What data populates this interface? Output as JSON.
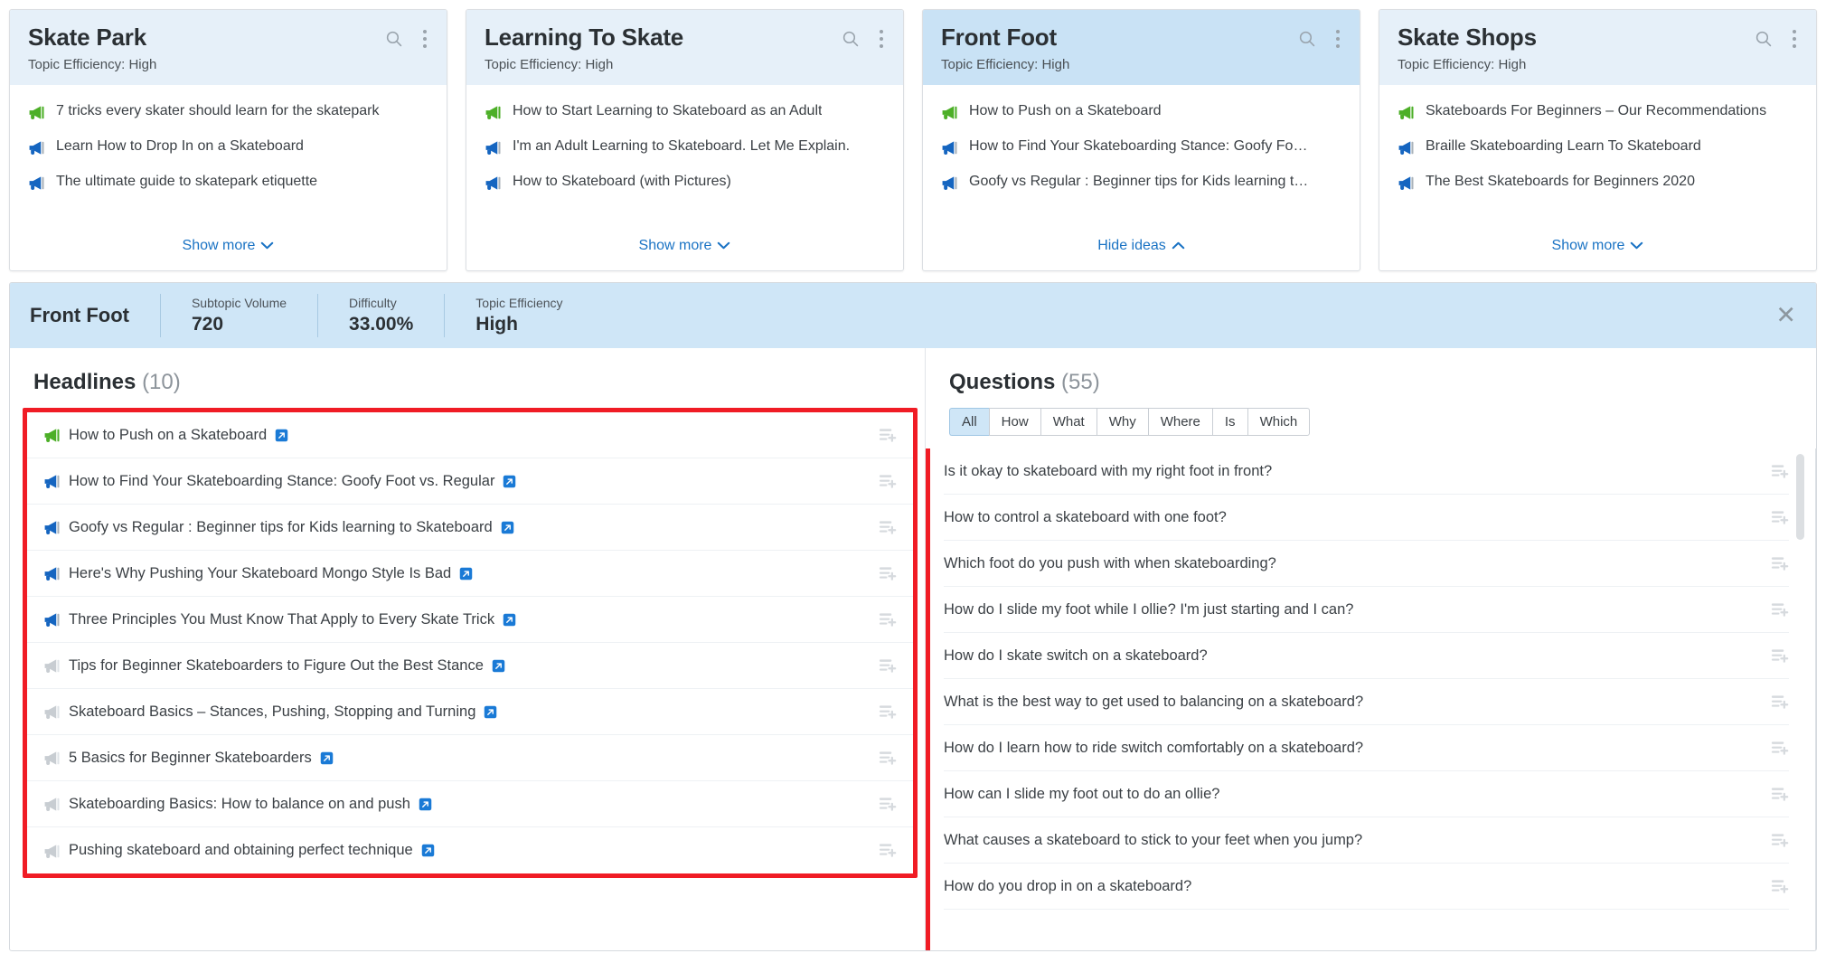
{
  "cards": [
    {
      "title": "Skate Park",
      "efficiency_label": "Topic Efficiency:",
      "efficiency_value": "High",
      "selected": false,
      "ideas": [
        {
          "text": "7 tricks every skater should learn for the skatepark",
          "state": "green"
        },
        {
          "text": "Learn How to Drop In on a Skateboard",
          "state": "blue"
        },
        {
          "text": "The ultimate guide to skatepark etiquette",
          "state": "blue"
        }
      ],
      "toggle_label": "Show more",
      "toggle_dir": "down"
    },
    {
      "title": "Learning To Skate",
      "efficiency_label": "Topic Efficiency:",
      "efficiency_value": "High",
      "selected": false,
      "ideas": [
        {
          "text": "How to Start Learning to Skateboard as an Adult",
          "state": "green"
        },
        {
          "text": "I'm an Adult Learning to Skateboard. Let Me Explain.",
          "state": "blue"
        },
        {
          "text": "How to Skateboard (with Pictures)",
          "state": "blue"
        }
      ],
      "toggle_label": "Show more",
      "toggle_dir": "down"
    },
    {
      "title": "Front Foot",
      "efficiency_label": "Topic Efficiency:",
      "efficiency_value": "High",
      "selected": true,
      "ideas": [
        {
          "text": "How to Push on a Skateboard",
          "state": "green"
        },
        {
          "text": "How to Find Your Skateboarding Stance: Goofy Fo…",
          "state": "blue"
        },
        {
          "text": "Goofy vs Regular : Beginner tips for Kids learning t…",
          "state": "blue"
        }
      ],
      "toggle_label": "Hide ideas",
      "toggle_dir": "up"
    },
    {
      "title": "Skate Shops",
      "efficiency_label": "Topic Efficiency:",
      "efficiency_value": "High",
      "selected": false,
      "ideas": [
        {
          "text": "Skateboards For Beginners – Our Recommendations",
          "state": "green"
        },
        {
          "text": "Braille Skateboarding Learn To Skateboard",
          "state": "blue"
        },
        {
          "text": "The Best Skateboards for Beginners 2020",
          "state": "blue"
        }
      ],
      "toggle_label": "Show more",
      "toggle_dir": "down"
    }
  ],
  "detail": {
    "title": "Front Foot",
    "metrics": [
      {
        "label": "Subtopic Volume",
        "value": "720"
      },
      {
        "label": "Difficulty",
        "value": "33.00%"
      },
      {
        "label": "Topic Efficiency",
        "value": "High"
      }
    ],
    "close_label": "✕",
    "headlines": {
      "title": "Headlines",
      "count": "(10)",
      "items": [
        {
          "text": "How to Push on a Skateboard",
          "state": "green"
        },
        {
          "text": "How to Find Your Skateboarding Stance: Goofy Foot vs. Regular",
          "state": "blue"
        },
        {
          "text": "Goofy vs Regular : Beginner tips for Kids learning to Skateboard",
          "state": "blue"
        },
        {
          "text": "Here's Why Pushing Your Skateboard Mongo Style Is Bad",
          "state": "blue"
        },
        {
          "text": "Three Principles You Must Know That Apply to Every Skate Trick",
          "state": "blue"
        },
        {
          "text": "Tips for Beginner Skateboarders to Figure Out the Best Stance",
          "state": "gray"
        },
        {
          "text": "Skateboard Basics – Stances, Pushing, Stopping and Turning",
          "state": "gray"
        },
        {
          "text": "5 Basics for Beginner Skateboarders",
          "state": "gray"
        },
        {
          "text": "Skateboarding Basics: How to balance on and push",
          "state": "gray"
        },
        {
          "text": "Pushing skateboard and obtaining perfect technique",
          "state": "gray"
        }
      ]
    },
    "questions": {
      "title": "Questions",
      "count": "(55)",
      "filters": [
        {
          "label": "All",
          "active": true
        },
        {
          "label": "How",
          "active": false
        },
        {
          "label": "What",
          "active": false
        },
        {
          "label": "Why",
          "active": false
        },
        {
          "label": "Where",
          "active": false
        },
        {
          "label": "Is",
          "active": false
        },
        {
          "label": "Which",
          "active": false
        }
      ],
      "items": [
        "Is it okay to skateboard with my right foot in front?",
        "How to control a skateboard with one foot?",
        "Which foot do you push with when skateboarding?",
        "How do I slide my foot while I ollie? I'm just starting and I can?",
        "How do I skate switch on a skateboard?",
        "What is the best way to get used to balancing on a skateboard?",
        "How do I learn how to ride switch comfortably on a skateboard?",
        "How can I slide my foot out to do an ollie?",
        "What causes a skateboard to stick to your feet when you jump?",
        "How do you drop in on a skateboard?"
      ]
    }
  },
  "colors": {
    "accent_link": "#1a73c4",
    "card_header": "#e6f0f9",
    "card_header_selected": "#c9e2f5",
    "detail_header": "#cfe6f7",
    "highlight_box": "#f01c25",
    "mega_green": "#4caf27",
    "mega_blue": "#1565c0",
    "mega_gray": "#c8cdd2"
  }
}
